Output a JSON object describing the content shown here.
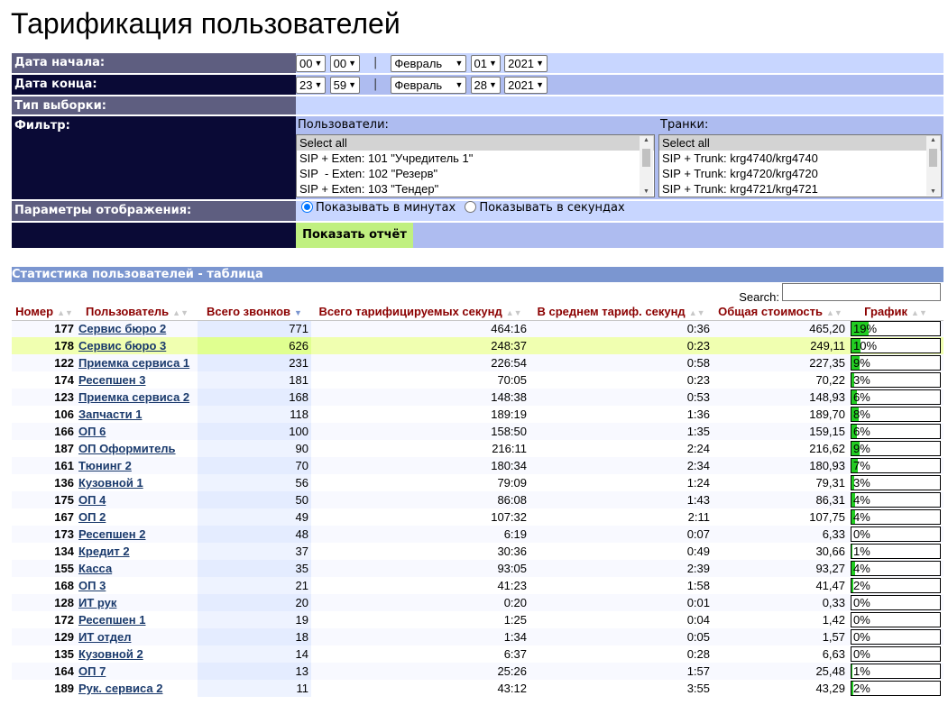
{
  "page_title": "Тарификация пользователей",
  "form": {
    "start_label": "Дата начала:",
    "end_label": "Дата конца:",
    "type_label": "Тип выборки:",
    "filter_label": "Фильтр:",
    "display_label": "Параметры отображения:",
    "start": {
      "hour": "00",
      "minute": "00",
      "month": "Февраль",
      "day": "01",
      "year": "2021"
    },
    "end": {
      "hour": "23",
      "minute": "59",
      "month": "Февраль",
      "day": "28",
      "year": "2021"
    },
    "separator": "|",
    "users_title": "Пользователи:",
    "users_options": [
      "Select all",
      "SIP + Exten: 101 \"Учредитель 1\"",
      "SIP  - Exten: 102 \"Резерв\"",
      "SIP + Exten: 103 \"Тендер\""
    ],
    "trunks_title": "Транки:",
    "trunks_options": [
      "Select all",
      "SIP + Trunk: krg4740/krg4740",
      "SIP + Trunk: krg4720/krg4720",
      "SIP + Trunk: krg4721/krg4721"
    ],
    "radio_minutes": "Показывать в минутах",
    "radio_seconds": "Показывать в секундах",
    "show_button": "Показать отчёт"
  },
  "stats": {
    "title": "Статистика пользователей - таблица",
    "search_label": "Search:",
    "columns": [
      "Номер",
      "Пользователь",
      "Всего звонков",
      "Всего тарифицируемых секунд",
      "В среднем тариф. секунд",
      "Общая стоимость",
      "График"
    ],
    "rows": [
      {
        "num": "177",
        "user": "Сервис бюро 2",
        "calls": "771",
        "secs": "464:16",
        "avg": "0:36",
        "cost": "465,20",
        "pct": "19%",
        "pct_val": 19
      },
      {
        "num": "178",
        "user": "Сервис бюро 3",
        "calls": "626",
        "secs": "248:37",
        "avg": "0:23",
        "cost": "249,11",
        "pct": "10%",
        "pct_val": 10
      },
      {
        "num": "122",
        "user": "Приемка сервиса 1",
        "calls": "231",
        "secs": "226:54",
        "avg": "0:58",
        "cost": "227,35",
        "pct": "9%",
        "pct_val": 9
      },
      {
        "num": "174",
        "user": "Ресепшен 3",
        "calls": "181",
        "secs": "70:05",
        "avg": "0:23",
        "cost": "70,22",
        "pct": "3%",
        "pct_val": 3
      },
      {
        "num": "123",
        "user": "Приемка сервиса 2",
        "calls": "168",
        "secs": "148:38",
        "avg": "0:53",
        "cost": "148,93",
        "pct": "6%",
        "pct_val": 6
      },
      {
        "num": "106",
        "user": "Запчасти 1",
        "calls": "118",
        "secs": "189:19",
        "avg": "1:36",
        "cost": "189,70",
        "pct": "8%",
        "pct_val": 8
      },
      {
        "num": "166",
        "user": "ОП 6",
        "calls": "100",
        "secs": "158:50",
        "avg": "1:35",
        "cost": "159,15",
        "pct": "6%",
        "pct_val": 6
      },
      {
        "num": "187",
        "user": "ОП Оформитель",
        "calls": "90",
        "secs": "216:11",
        "avg": "2:24",
        "cost": "216,62",
        "pct": "9%",
        "pct_val": 9
      },
      {
        "num": "161",
        "user": "Тюнинг 2",
        "calls": "70",
        "secs": "180:34",
        "avg": "2:34",
        "cost": "180,93",
        "pct": "7%",
        "pct_val": 7
      },
      {
        "num": "136",
        "user": "Кузовной 1",
        "calls": "56",
        "secs": "79:09",
        "avg": "1:24",
        "cost": "79,31",
        "pct": "3%",
        "pct_val": 3
      },
      {
        "num": "175",
        "user": "ОП 4",
        "calls": "50",
        "secs": "86:08",
        "avg": "1:43",
        "cost": "86,31",
        "pct": "4%",
        "pct_val": 4
      },
      {
        "num": "167",
        "user": "ОП 2",
        "calls": "49",
        "secs": "107:32",
        "avg": "2:11",
        "cost": "107,75",
        "pct": "4%",
        "pct_val": 4
      },
      {
        "num": "173",
        "user": "Ресепшен 2",
        "calls": "48",
        "secs": "6:19",
        "avg": "0:07",
        "cost": "6,33",
        "pct": "0%",
        "pct_val": 0
      },
      {
        "num": "134",
        "user": "Кредит 2",
        "calls": "37",
        "secs": "30:36",
        "avg": "0:49",
        "cost": "30,66",
        "pct": "1%",
        "pct_val": 1
      },
      {
        "num": "155",
        "user": "Касса",
        "calls": "35",
        "secs": "93:05",
        "avg": "2:39",
        "cost": "93,27",
        "pct": "4%",
        "pct_val": 4
      },
      {
        "num": "168",
        "user": "ОП 3",
        "calls": "21",
        "secs": "41:23",
        "avg": "1:58",
        "cost": "41,47",
        "pct": "2%",
        "pct_val": 2
      },
      {
        "num": "128",
        "user": "ИТ рук",
        "calls": "20",
        "secs": "0:20",
        "avg": "0:01",
        "cost": "0,33",
        "pct": "0%",
        "pct_val": 0
      },
      {
        "num": "172",
        "user": "Ресепшен 1",
        "calls": "19",
        "secs": "1:25",
        "avg": "0:04",
        "cost": "1,42",
        "pct": "0%",
        "pct_val": 0
      },
      {
        "num": "129",
        "user": "ИТ отдел",
        "calls": "18",
        "secs": "1:34",
        "avg": "0:05",
        "cost": "1,57",
        "pct": "0%",
        "pct_val": 0
      },
      {
        "num": "135",
        "user": "Кузовной 2",
        "calls": "14",
        "secs": "6:37",
        "avg": "0:28",
        "cost": "6,63",
        "pct": "0%",
        "pct_val": 0
      },
      {
        "num": "164",
        "user": "ОП 7",
        "calls": "13",
        "secs": "25:26",
        "avg": "1:57",
        "cost": "25,48",
        "pct": "1%",
        "pct_val": 1
      },
      {
        "num": "189",
        "user": "Рук. сервиса 2",
        "calls": "11",
        "secs": "43:12",
        "avg": "3:55",
        "cost": "43,29",
        "pct": "2%",
        "pct_val": 2
      }
    ],
    "highlight_row": 1,
    "bar_color": "#22cc22"
  }
}
